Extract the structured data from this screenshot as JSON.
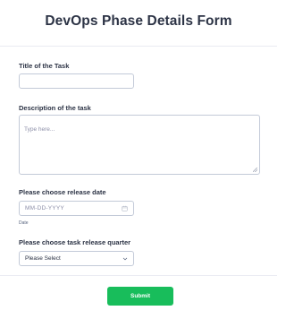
{
  "form": {
    "title": "DevOps Phase Details Form"
  },
  "fields": {
    "task_title": {
      "label": "Title of the Task",
      "value": ""
    },
    "task_description": {
      "label": "Description of the task",
      "placeholder": "Type here..."
    },
    "release_date": {
      "label": "Please choose release date",
      "placeholder": "MM-DD-YYYY",
      "sublabel": "Date"
    },
    "release_quarter": {
      "label": "Please choose task release quarter",
      "selected": "Please Select"
    }
  },
  "footer": {
    "submit_label": "Submit"
  },
  "colors": {
    "accent": "#18bd5b",
    "text": "#2c3345",
    "border": "#c3cad8"
  },
  "icons": {
    "date_picker": "calendar-icon",
    "dropdown": "chevron-down-icon"
  }
}
